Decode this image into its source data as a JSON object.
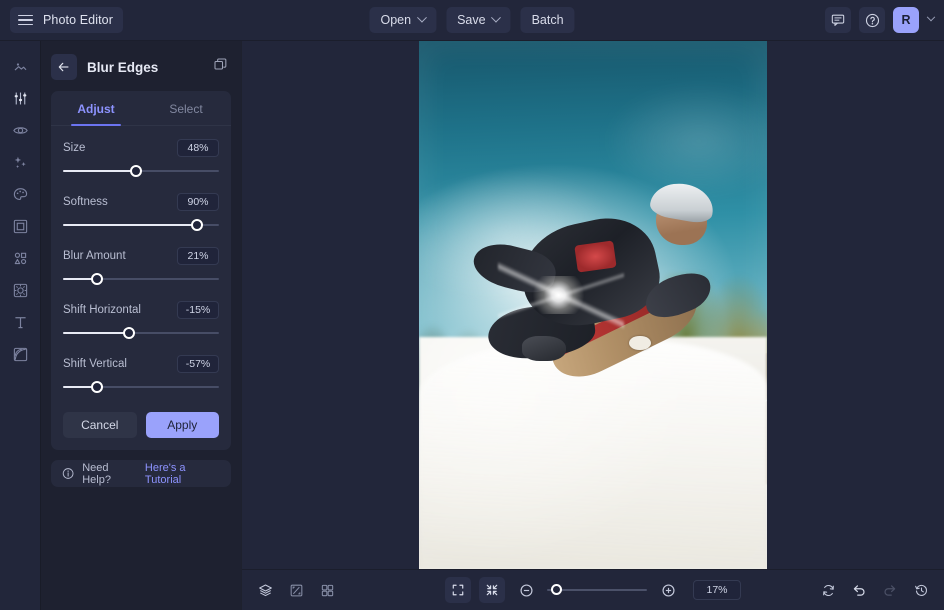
{
  "app": {
    "brand_label": "Photo Editor",
    "accent": "#9aa2fb",
    "accent_link": "#8d93ff",
    "bar_bg": "#22263a",
    "panel_bg": "#1e2130",
    "card_bg": "#262a3d"
  },
  "topbar": {
    "menu_icon": "hamburger-icon",
    "buttons": [
      {
        "label": "Open",
        "caret": true
      },
      {
        "label": "Save",
        "caret": true
      },
      {
        "label": "Batch",
        "caret": false
      }
    ],
    "feedback_icon": "chat-bubble-icon",
    "help_icon": "question-circle-icon",
    "avatar_initial": "R",
    "avatar_caret": "chevron-down-icon"
  },
  "rail": {
    "items": [
      {
        "name": "image-tool",
        "icon": "image-icon",
        "active": false
      },
      {
        "name": "adjust-tool",
        "icon": "sliders-icon",
        "active": false
      },
      {
        "name": "effects-tool",
        "icon": "eye-icon",
        "active": false
      },
      {
        "name": "enhance-tool",
        "icon": "sparkles-icon",
        "active": false
      },
      {
        "name": "color-tool",
        "icon": "palette-icon",
        "active": false
      },
      {
        "name": "frames-tool",
        "icon": "frame-icon",
        "active": false
      },
      {
        "name": "shapes-tool",
        "icon": "shapes-icon",
        "active": false
      },
      {
        "name": "stickers-tool",
        "icon": "sticker-icon",
        "active": false
      },
      {
        "name": "text-tool",
        "icon": "text-icon",
        "active": false
      },
      {
        "name": "overlays-tool",
        "icon": "overlay-icon",
        "active": false
      }
    ]
  },
  "panel": {
    "back_icon": "arrow-left-icon",
    "title": "Blur Edges",
    "duplicate_icon": "copy-layers-icon",
    "tabs": [
      {
        "label": "Adjust",
        "active": true
      },
      {
        "label": "Select",
        "active": false
      }
    ],
    "sliders": [
      {
        "label": "Size",
        "value": "48%",
        "pct": 47
      },
      {
        "label": "Softness",
        "value": "90%",
        "pct": 86
      },
      {
        "label": "Blur Amount",
        "value": "21%",
        "pct": 22
      },
      {
        "label": "Shift Horizontal",
        "value": "-15%",
        "pct": 42
      },
      {
        "label": "Shift Vertical",
        "value": "-57%",
        "pct": 22
      }
    ],
    "cancel_label": "Cancel",
    "apply_label": "Apply",
    "help": {
      "icon": "info-circle-icon",
      "text": "Need Help?",
      "link": "Here's a Tutorial"
    }
  },
  "canvas": {
    "subject": "skateboarder mid-air over a skatepark bowl with sun flare and teal sky"
  },
  "bottombar": {
    "left_tools": [
      {
        "name": "layers-button",
        "icon": "layers-icon"
      },
      {
        "name": "compare-button",
        "icon": "compare-split-icon"
      },
      {
        "name": "grid-button",
        "icon": "grid-icon"
      }
    ],
    "fit_icon": "fit-to-screen-icon",
    "shrink_icon": "collapse-arrows-icon",
    "zoom_out_icon": "minus-circle-icon",
    "zoom_in_icon": "plus-circle-icon",
    "zoom_value": "17%",
    "zoom_pct": 9,
    "right_tools": [
      {
        "name": "reset-button",
        "icon": "refresh-icon",
        "disabled": false
      },
      {
        "name": "undo-button",
        "icon": "undo-arrow-icon",
        "disabled": false
      },
      {
        "name": "redo-button",
        "icon": "redo-arrow-icon",
        "disabled": true
      },
      {
        "name": "history-button",
        "icon": "history-clock-icon",
        "disabled": false
      }
    ]
  }
}
